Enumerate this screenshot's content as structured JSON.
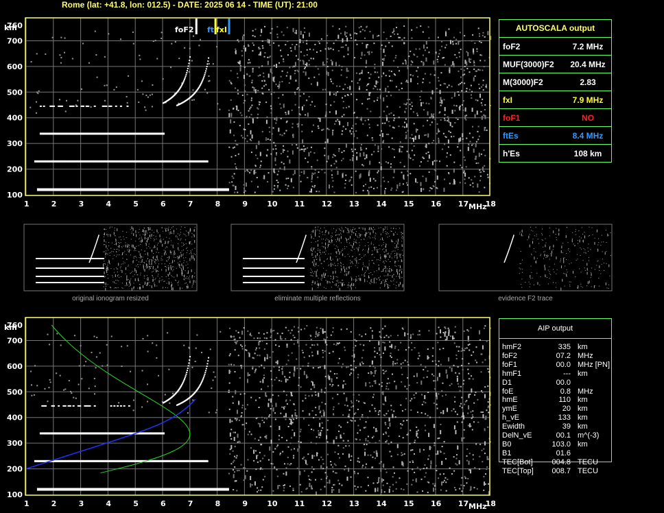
{
  "header": {
    "title": "Rome (lat: +41.8, lon: 012.5) - DATE: 2025 06 14 - TIME (UT): 21:00"
  },
  "axes": {
    "y_unit": "km",
    "x_unit": "MHz",
    "y_ticks": [
      100,
      200,
      300,
      400,
      500,
      600,
      700,
      760
    ],
    "x_ticks": [
      1,
      2,
      3,
      4,
      5,
      6,
      7,
      8,
      9,
      10,
      11,
      12,
      13,
      14,
      15,
      16,
      17,
      18
    ]
  },
  "markers": {
    "foF2": "foF2",
    "ftEs": "ft",
    "fxI": "fxI"
  },
  "autoscala": {
    "title": "AUTOSCALA output",
    "rows": [
      {
        "key": "foF2",
        "value": "7.2 MHz",
        "color": "#ffffff"
      },
      {
        "key": "MUF(3000)F2",
        "value": "20.4 MHz",
        "color": "#ffffff"
      },
      {
        "key": "M(3000)F2",
        "value": "2.83",
        "color": "#ffffff"
      },
      {
        "key": "fxI",
        "value": "7.9 MHz",
        "color": "#ffff33"
      },
      {
        "key": "foF1",
        "value": "NO",
        "color": "#ff2222"
      },
      {
        "key": "ftEs",
        "value": "8.4 MHz",
        "color": "#3399ff"
      },
      {
        "key": "h'Es",
        "value": "108   km",
        "color": "#ffffff"
      }
    ]
  },
  "thumbnails": [
    {
      "caption": "original ionogram resized"
    },
    {
      "caption": "eliminate multiple reflections"
    },
    {
      "caption": "evidence F2 trace"
    }
  ],
  "aip": {
    "title": "AIP output",
    "rows": [
      {
        "k": "hmF2",
        "v": "335",
        "u": "km"
      },
      {
        "k": "foF2",
        "v": "07.2",
        "u": "MHz"
      },
      {
        "k": "foF1",
        "v": "00.0",
        "u": "MHz   [PN]"
      },
      {
        "k": "hmF1",
        "v": "---",
        "u": "km"
      },
      {
        "k": "D1",
        "v": "00.0",
        "u": ""
      },
      {
        "k": "foE",
        "v": "0.8",
        "u": "MHz"
      },
      {
        "k": "hmE",
        "v": "110",
        "u": "km"
      },
      {
        "k": "ymE",
        "v": "20",
        "u": "km"
      },
      {
        "k": "h_vE",
        "v": "133",
        "u": "km"
      },
      {
        "k": "Ewidth",
        "v": "39",
        "u": "km"
      },
      {
        "k": "DelN_vE",
        "v": "00.1",
        "u": "m^(-3)"
      },
      {
        "k": "B0",
        "v": "103.0",
        "u": "km"
      },
      {
        "k": "B1",
        "v": "01.6",
        "u": ""
      },
      {
        "k": "TEC[Bot]",
        "v": "004.8",
        "u": "TECU"
      },
      {
        "k": "TEC[Top]",
        "v": "008.7",
        "u": "TECU"
      }
    ]
  },
  "colors": {
    "frame": "#ffff66",
    "grid": "#777777",
    "panel_border": "#66ff66",
    "profile_green": "#22dd22",
    "profile_blue": "#2233ff"
  }
}
